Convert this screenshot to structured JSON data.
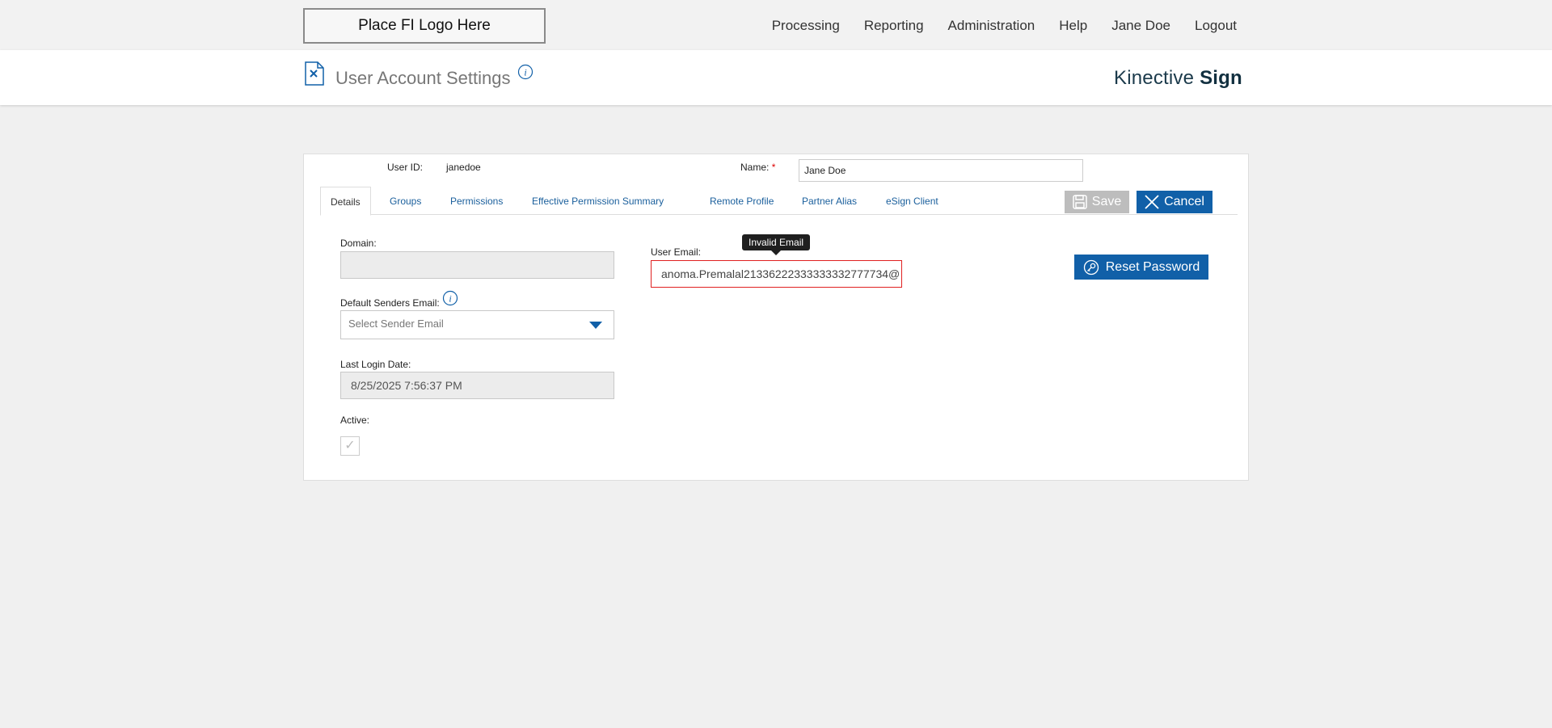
{
  "topbar": {
    "logo_text": "Place FI Logo Here",
    "nav": [
      "Processing",
      "Reporting",
      "Administration",
      "Help",
      "Jane Doe",
      "Logout"
    ]
  },
  "header": {
    "title": "User Account Settings",
    "brand_regular": "Kinective",
    "brand_bold": "Sign"
  },
  "user": {
    "id_label": "User ID:",
    "id_value": "janedoe",
    "name_label": "Name:",
    "name_required": "*",
    "name_value": "Jane Doe"
  },
  "tabs": [
    "Details",
    "Groups",
    "Permissions",
    "Effective Permission Summary",
    "Remote Profile",
    "Partner Alias",
    "eSign Client"
  ],
  "actions": {
    "save_label": "Save",
    "cancel_label": "Cancel",
    "reset_password_label": "Reset Password"
  },
  "form": {
    "domain_label": "Domain:",
    "domain_value": "",
    "default_senders_label": "Default Senders Email:",
    "default_senders_placeholder": "Select Sender Email",
    "last_login_label": "Last Login Date:",
    "last_login_value": "8/25/2025 7:56:37 PM",
    "active_label": "Active:",
    "active_checked": true,
    "email_label": "User Email:",
    "email_value": "anoma.Premalal21336222333333332777734@",
    "email_error": "Invalid Email"
  },
  "colors": {
    "accent": "#1160a8",
    "error": "#e02020",
    "disabled_button": "#bdbdbd",
    "brand": "#1b3a4b"
  }
}
